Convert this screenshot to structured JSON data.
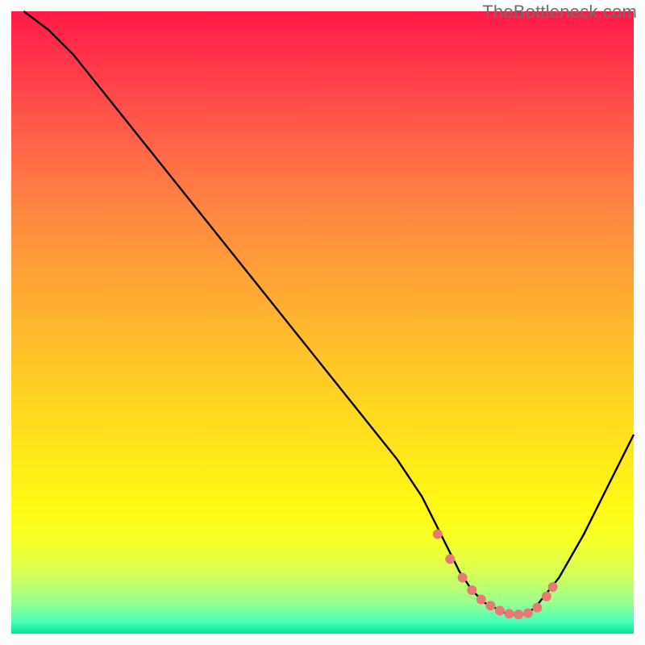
{
  "watermark": "TheBottleneck.com",
  "colors": {
    "curve": "#000000",
    "dot": "#e77a73",
    "gradient_top": "#ff1948",
    "gradient_bottom": "#00e893"
  },
  "chart_data": {
    "type": "line",
    "title": "",
    "xlabel": "",
    "ylabel": "",
    "xlim": [
      0,
      100
    ],
    "ylim": [
      0,
      100
    ],
    "grid": false,
    "legend": false,
    "series": [
      {
        "name": "bottleneck-curve",
        "x": [
          2,
          6,
          10,
          14,
          18,
          22,
          26,
          30,
          34,
          38,
          42,
          46,
          50,
          54,
          58,
          62,
          66,
          68,
          70,
          72,
          74,
          76,
          78,
          80,
          82,
          84,
          88,
          92,
          96,
          100
        ],
        "values": [
          100,
          97,
          93,
          88,
          83,
          78,
          73,
          68,
          63,
          58,
          53,
          48,
          43,
          38,
          33,
          28,
          22,
          18,
          14,
          10,
          7,
          5,
          4,
          3,
          3,
          4,
          9,
          16,
          24,
          32
        ]
      }
    ],
    "highlight_points": {
      "name": "optimal-range-dots",
      "x": [
        68.5,
        70.5,
        72.5,
        74.0,
        75.5,
        77.0,
        78.5,
        80.0,
        81.5,
        83.0,
        84.5,
        86.0,
        87.0
      ],
      "values": [
        16.0,
        12.0,
        9.0,
        7.0,
        5.5,
        4.5,
        3.7,
        3.2,
        3.1,
        3.3,
        4.2,
        6.0,
        7.5
      ]
    }
  }
}
